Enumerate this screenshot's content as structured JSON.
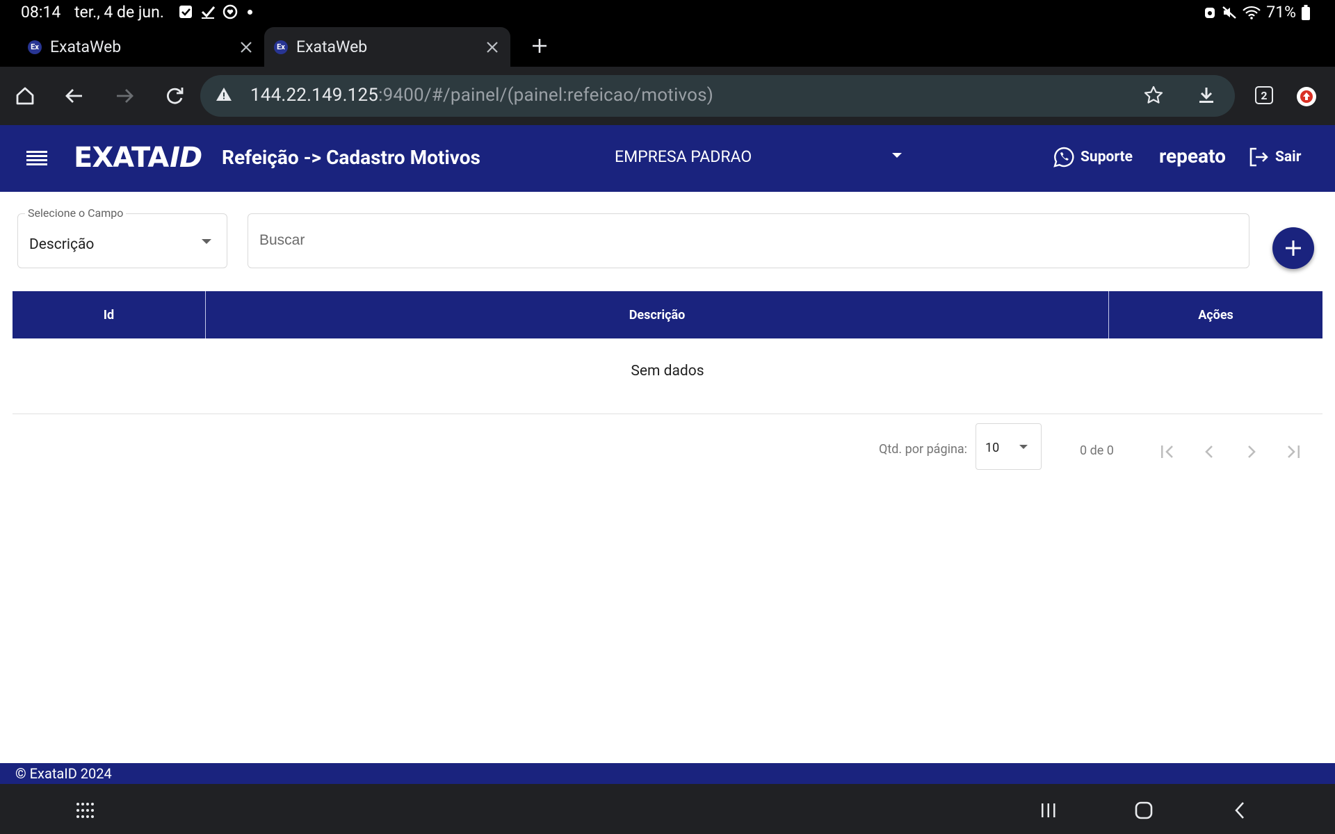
{
  "status_bar": {
    "time": "08:14",
    "date": "ter., 4 de jun.",
    "battery": "71%"
  },
  "browser": {
    "tabs": [
      {
        "favicon": "Ex",
        "title": "ExataWeb",
        "active": false
      },
      {
        "favicon": "Ex",
        "title": "ExataWeb",
        "active": true
      }
    ],
    "url_host": "144.22.149.125",
    "url_rest": ":9400/#/painel/(painel:refeicao/motivos)",
    "tab_count": "2"
  },
  "app": {
    "logo_main": "EXATA",
    "logo_suffix": "ID",
    "page_title": "Refeição -> Cadastro Motivos",
    "company": "EMPRESA PADRAO",
    "support_label": "Suporte",
    "username": "repeato",
    "logout_label": "Sair",
    "primary_color": "#1a237e"
  },
  "filters": {
    "field_label": "Selecione o Campo",
    "field_value": "Descrição",
    "search_placeholder": "Buscar",
    "search_value": ""
  },
  "table": {
    "columns": [
      "Id",
      "Descrição",
      "Ações"
    ],
    "rows": [],
    "empty_text": "Sem dados"
  },
  "paginator": {
    "page_size_label": "Qtd. por página:",
    "page_size": "10",
    "range_label": "0 de 0"
  },
  "footer": {
    "text": "© ExataID 2024"
  }
}
